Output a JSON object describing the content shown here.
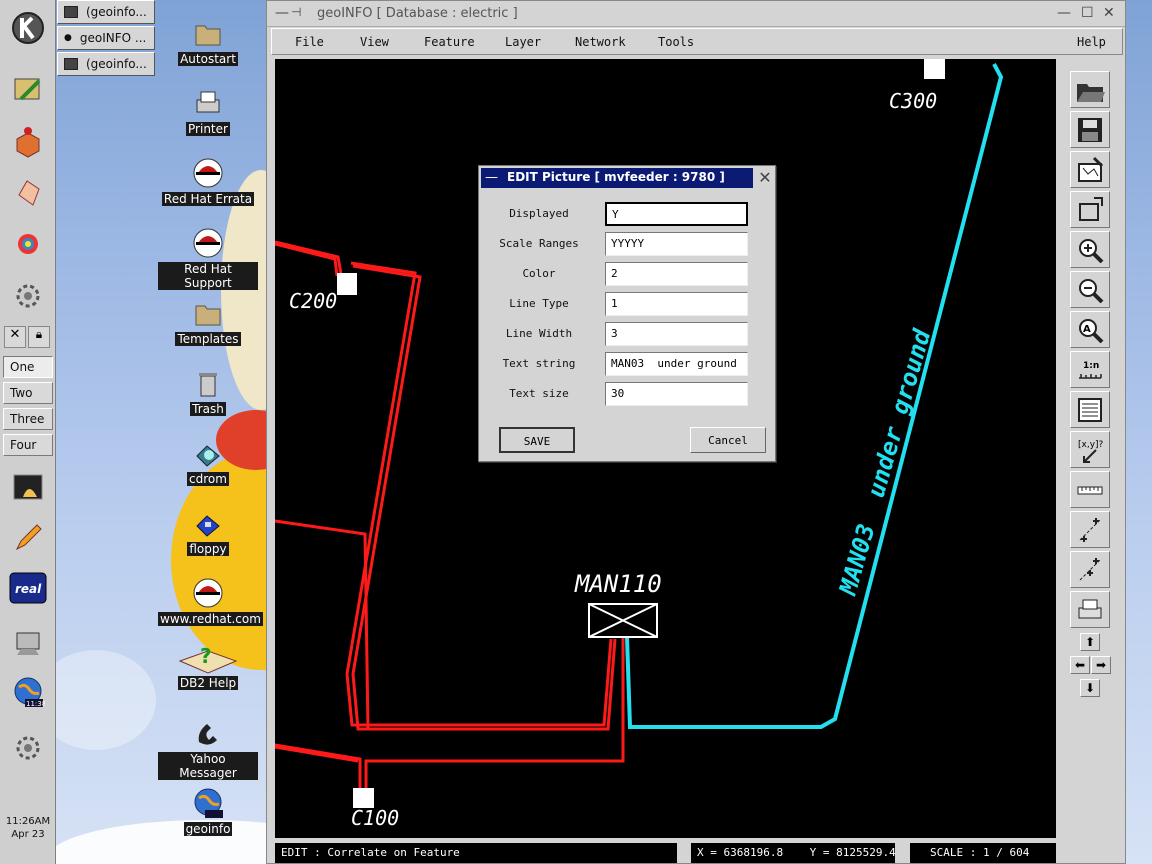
{
  "taskbar": {
    "tasks": [
      {
        "label": "(geoinfo..."
      },
      {
        "label": "geoINFO ..."
      },
      {
        "label": "(geoinfo..."
      }
    ]
  },
  "panel": {
    "desktops": [
      "One",
      "Two",
      "Three",
      "Four"
    ],
    "active_desktop": "One",
    "clock_time": "11:26AM",
    "clock_date": "Apr 23"
  },
  "desktop_icons": [
    {
      "label": "Autostart",
      "icon": "folder-icon"
    },
    {
      "label": "Printer",
      "icon": "printer-icon"
    },
    {
      "label": "Red Hat Errata",
      "icon": "redhat-icon"
    },
    {
      "label": "Red Hat Support",
      "icon": "redhat-icon"
    },
    {
      "label": "Templates",
      "icon": "folder-icon"
    },
    {
      "label": "Trash",
      "icon": "trash-icon"
    },
    {
      "label": "cdrom",
      "icon": "cdrom-icon"
    },
    {
      "label": "floppy",
      "icon": "floppy-icon"
    },
    {
      "label": "www.redhat.com",
      "icon": "redhat-icon"
    },
    {
      "label": "DB2 Help",
      "icon": "help-book-icon"
    },
    {
      "label": "Yahoo Messager",
      "icon": "phone-icon"
    },
    {
      "label": "geoinfo",
      "icon": "globe-icon"
    }
  ],
  "window": {
    "title": "geoINFO  [ Database : electric ]",
    "menus": [
      "File",
      "View",
      "Feature",
      "Layer",
      "Network",
      "Tools",
      "Help"
    ]
  },
  "map": {
    "labels": {
      "c300": "C300",
      "c200": "C200",
      "c100": "C100",
      "man110": "MAN110",
      "cable_text": "MAN03  under ground"
    },
    "colors": {
      "background": "#000000",
      "cable_red": "#ff1a1a",
      "cable_cyan": "#22e0f0",
      "text": "#ffffff"
    }
  },
  "dialog": {
    "title": "EDIT Picture [ mvfeeder :  9780 ]",
    "fields": [
      {
        "label": "Displayed",
        "value": "Y"
      },
      {
        "label": "Scale Ranges",
        "value": "YYYYY"
      },
      {
        "label": "Color",
        "value": "2"
      },
      {
        "label": "Line Type",
        "value": "1"
      },
      {
        "label": "Line Width",
        "value": "3"
      },
      {
        "label": "Text string",
        "value": "MAN03  under ground"
      },
      {
        "label": "Text size",
        "value": "30"
      }
    ],
    "save_label": "SAVE",
    "cancel_label": "Cancel"
  },
  "status": {
    "mode": "EDIT : Correlate on Feature",
    "x": "X = 6368196.8",
    "y": "Y = 8125529.4",
    "scale": "SCALE :  1 / 604"
  },
  "toolbar_tools": [
    "open-folder-icon",
    "save-disk-icon",
    "print-map-icon",
    "select-rectangle-icon",
    "zoom-in-icon",
    "zoom-out-icon",
    "zoom-extent-icon",
    "scale-1n-icon",
    "layer-list-icon",
    "xy-coordinate-icon",
    "measure-ruler-icon",
    "move-vertex-icon",
    "add-vertex-icon",
    "printer-icon"
  ]
}
